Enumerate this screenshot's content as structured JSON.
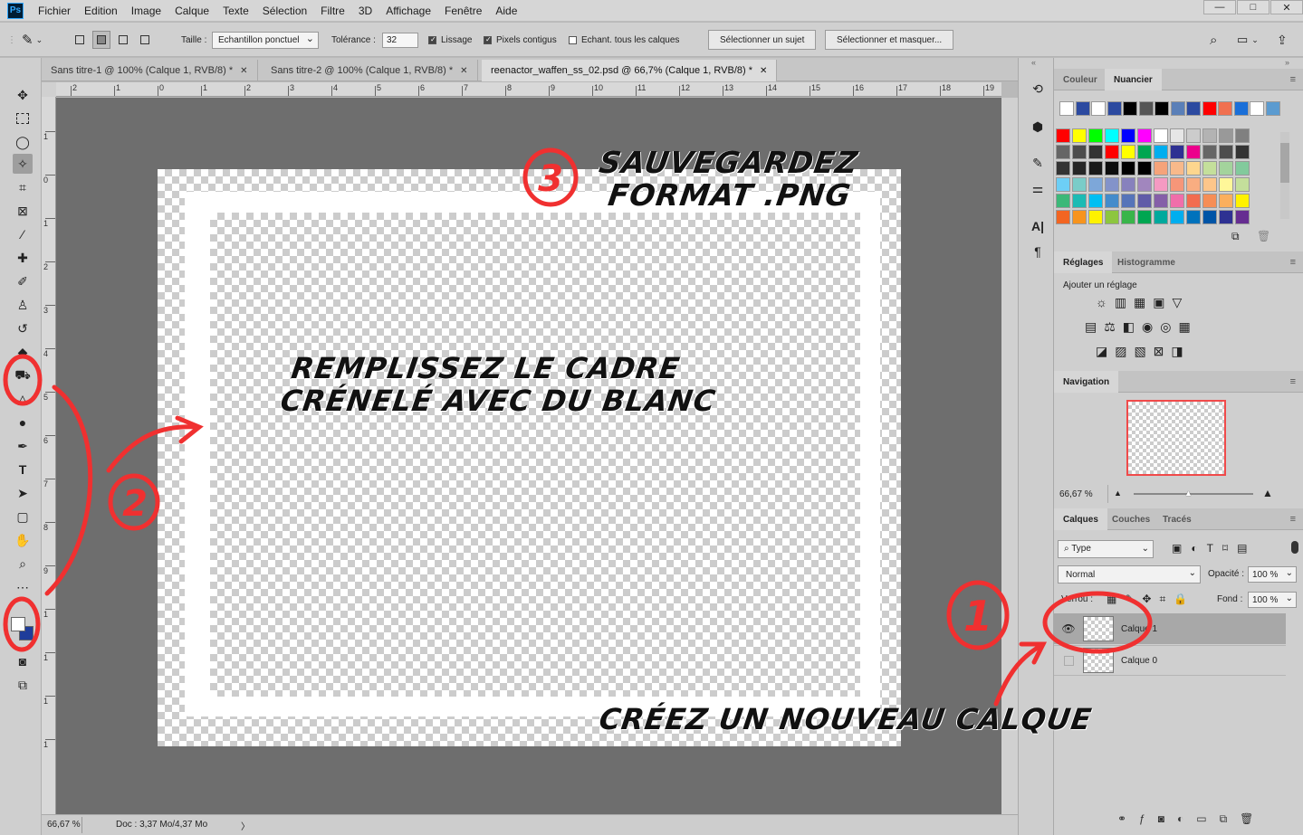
{
  "app": {
    "logo": "Ps",
    "menu": [
      "Fichier",
      "Edition",
      "Image",
      "Calque",
      "Texte",
      "Sélection",
      "Filtre",
      "3D",
      "Affichage",
      "Fenêtre",
      "Aide"
    ],
    "window_controls": [
      "—",
      "□",
      "✕"
    ]
  },
  "options": {
    "size_label": "Taille :",
    "size_value": "Echantillon ponctuel",
    "tolerance_label": "Tolérance :",
    "tolerance_value": "32",
    "antialias_label": "Lissage",
    "contiguous_label": "Pixels contigus",
    "all_layers_label": "Echant. tous les calques",
    "select_subject": "Sélectionner un sujet",
    "select_mask": "Sélectionner et masquer..."
  },
  "tabs": [
    {
      "label": "Sans titre-1 @ 100% (Calque 1, RVB/8) *",
      "close": "✕"
    },
    {
      "label": "Sans titre-2 @ 100% (Calque 1, RVB/8) *",
      "close": "✕"
    },
    {
      "label": "reenactor_waffen_ss_02.psd @ 66,7% (Calque 1, RVB/8) *",
      "close": "✕"
    }
  ],
  "ruler_h": [
    "2",
    "1",
    "0",
    "1",
    "2",
    "3",
    "4",
    "5",
    "6",
    "7",
    "8",
    "9",
    "10",
    "11",
    "12",
    "13",
    "14",
    "15",
    "16",
    "17",
    "18",
    "19"
  ],
  "ruler_v": [
    "1",
    "0",
    "1",
    "2",
    "3",
    "4",
    "5",
    "6",
    "7",
    "8",
    "9",
    "1",
    "1",
    "1",
    "1"
  ],
  "status": {
    "zoom": "66,67 %",
    "doc": "Doc : 3,37 Mo/4,37 Mo",
    "arrow": "〉"
  },
  "swatches_panel": {
    "tabs": [
      "Couleur",
      "Nuancier"
    ],
    "row0": [
      "#ffffff",
      "#2c4aa0",
      "#ffffff",
      "#2c4aa0",
      "#000000",
      "#555555",
      "#000000",
      "#5a7fb8",
      "#2c4aa0",
      "#ff0000",
      "#f07050",
      "#1a6fd8",
      "#ffffff",
      "#5b9bd0"
    ],
    "grid": [
      [
        "#ff0000",
        "#ffff00",
        "#00ff00",
        "#00ffff",
        "#0000ff",
        "#ff00ff",
        "#ffffff",
        "#e6e6e6",
        "#cccccc",
        "#b3b3b3",
        "#999999",
        "#808080"
      ],
      [
        "#666666",
        "#4d4d4d",
        "#333333",
        "#ff0000",
        "#ffff00",
        "#00a651",
        "#00aeef",
        "#2e3192",
        "#ec008c",
        "#666666",
        "#4d4d4d",
        "#333333"
      ],
      [
        "#333333",
        "#262626",
        "#1a1a1a",
        "#0d0d0d",
        "#000000",
        "#000000",
        "#f5a37a",
        "#f8b98a",
        "#fdd68e",
        "#c4df9b",
        "#a3d39c",
        "#82ca9c"
      ],
      [
        "#6dcff6",
        "#7accc8",
        "#7da7d9",
        "#8393ca",
        "#8781bd",
        "#a186be",
        "#f49ac2",
        "#f69679",
        "#f9ad81",
        "#fdc68a",
        "#fff799",
        "#c4df9b"
      ],
      [
        "#3cb878",
        "#1cbbb4",
        "#00bff3",
        "#448ccb",
        "#5674b9",
        "#605ca8",
        "#855fa8",
        "#f06eaa",
        "#f26c4f",
        "#f68e56",
        "#fbaf5d",
        "#fff200"
      ],
      [
        "#f26522",
        "#f7941d",
        "#fff200",
        "#8dc63f",
        "#39b54a",
        "#00a651",
        "#00a99d",
        "#00aeef",
        "#0072bc",
        "#0054a6",
        "#2e3192",
        "#662d91"
      ]
    ]
  },
  "adjustments": {
    "tabs": [
      "Réglages",
      "Histogramme"
    ],
    "add_label": "Ajouter un réglage"
  },
  "navigation": {
    "title": "Navigation",
    "zoom": "66,67 %"
  },
  "layers": {
    "tabs": [
      "Calques",
      "Couches",
      "Tracés"
    ],
    "filter": "Type",
    "blend_mode": "Normal",
    "opacity_label": "Opacité :",
    "opacity_value": "100 %",
    "lock_label": "Verrou :",
    "fill_label": "Fond :",
    "fill_value": "100 %",
    "items": [
      {
        "name": "Calque 1",
        "visible": true,
        "selected": true
      },
      {
        "name": "Calque 0",
        "visible": false,
        "selected": false
      }
    ]
  },
  "annotations": {
    "save": "SAUVEGARDEZ",
    "format": "FORMAT .PNG",
    "fill_line1": "REMPLISSEZ LE CADRE",
    "fill_line2": "CRÉNELÉ AVEC DU BLANC",
    "new_layer": "CRÉEZ UN NOUVEAU CALQUE",
    "step1": "1",
    "step2": "2",
    "step3": "3"
  },
  "colors": {
    "annotation_red": "#f03030",
    "foreground": "#ffffff",
    "background": "#1f3c9a"
  }
}
